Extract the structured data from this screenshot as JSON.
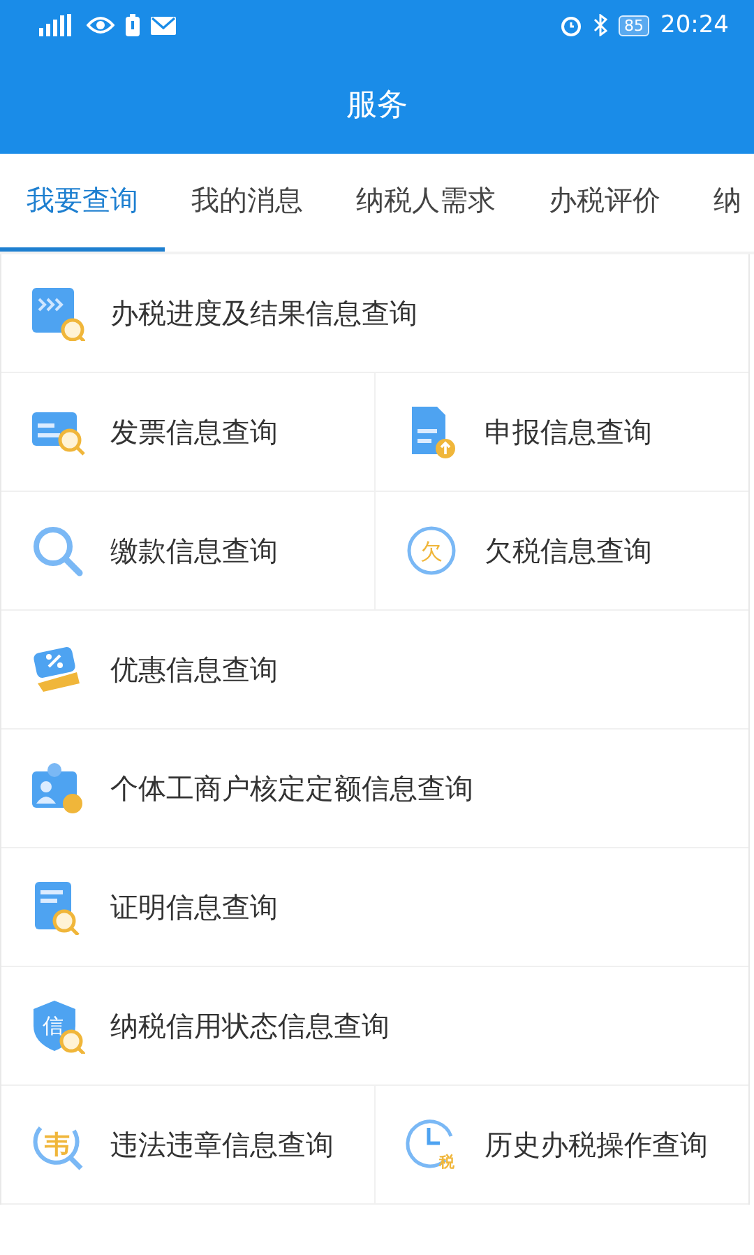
{
  "status_bar": {
    "battery": "85",
    "time": "20:24"
  },
  "header": {
    "title": "服务"
  },
  "tabs": [
    {
      "label": "我要查询",
      "selected": true
    },
    {
      "label": "我的消息",
      "selected": false
    },
    {
      "label": "纳税人需求",
      "selected": false
    },
    {
      "label": "办税评价",
      "selected": false
    },
    {
      "label": "纳",
      "selected": false
    }
  ],
  "rows": [
    {
      "cells": [
        {
          "label": "办税进度及结果信息查询"
        }
      ]
    },
    {
      "cells": [
        {
          "label": "发票信息查询"
        },
        {
          "label": "申报信息查询"
        }
      ]
    },
    {
      "cells": [
        {
          "label": "缴款信息查询"
        },
        {
          "label": "欠税信息查询",
          "icon_text": "欠"
        }
      ]
    },
    {
      "cells": [
        {
          "label": "优惠信息查询"
        }
      ]
    },
    {
      "cells": [
        {
          "label": "个体工商户核定定额信息查询"
        }
      ]
    },
    {
      "cells": [
        {
          "label": "证明信息查询"
        }
      ]
    },
    {
      "cells": [
        {
          "label": "纳税信用状态信息查询",
          "icon_text": "信"
        }
      ]
    },
    {
      "cells": [
        {
          "label": "违法违章信息查询",
          "icon_text": "韦"
        },
        {
          "label": "历史办税操作查询",
          "icon_text": "税"
        }
      ]
    }
  ]
}
